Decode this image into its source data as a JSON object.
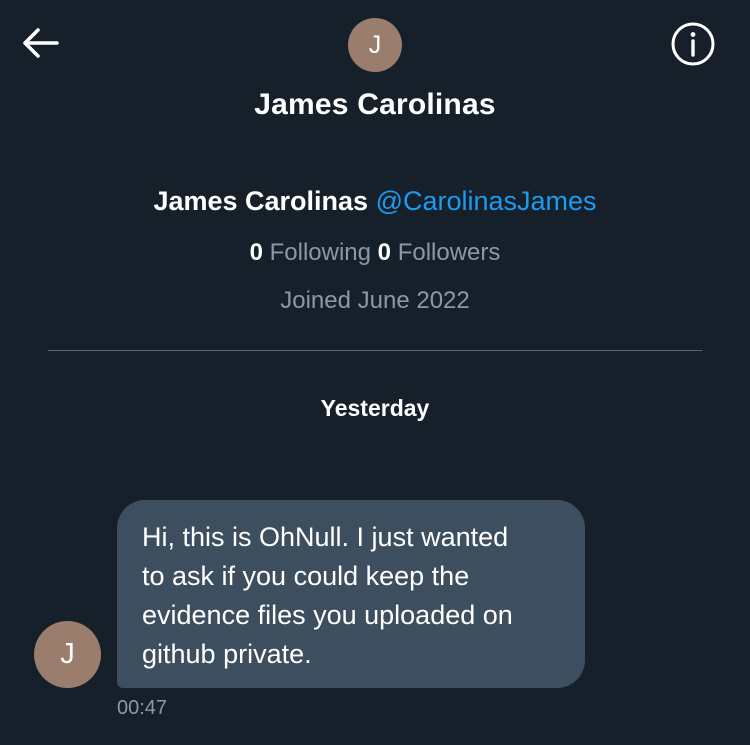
{
  "header": {
    "back_icon": "arrow-left-icon",
    "avatar_initial": "J",
    "title": "James Carolinas",
    "info_icon": "info-circle-icon"
  },
  "profile": {
    "name": "James Carolinas",
    "handle": "@CarolinasJames",
    "following_count": "0",
    "following_label": "Following",
    "followers_count": "0",
    "followers_label": "Followers",
    "joined": "Joined June 2022"
  },
  "conversation": {
    "date_separator": "Yesterday",
    "messages": [
      {
        "sender_initial": "J",
        "lines": [
          "Hi, this is OhNull. I just wanted",
          "to ask if you could keep the",
          "evidence files you uploaded on",
          "github private."
        ],
        "time": "00:47"
      }
    ]
  },
  "colors": {
    "background": "#15202b",
    "accent": "#1d9bf0",
    "bubble": "#3d4e5f",
    "avatar": "#9b7d6e",
    "muted_text": "#8b98a5"
  }
}
